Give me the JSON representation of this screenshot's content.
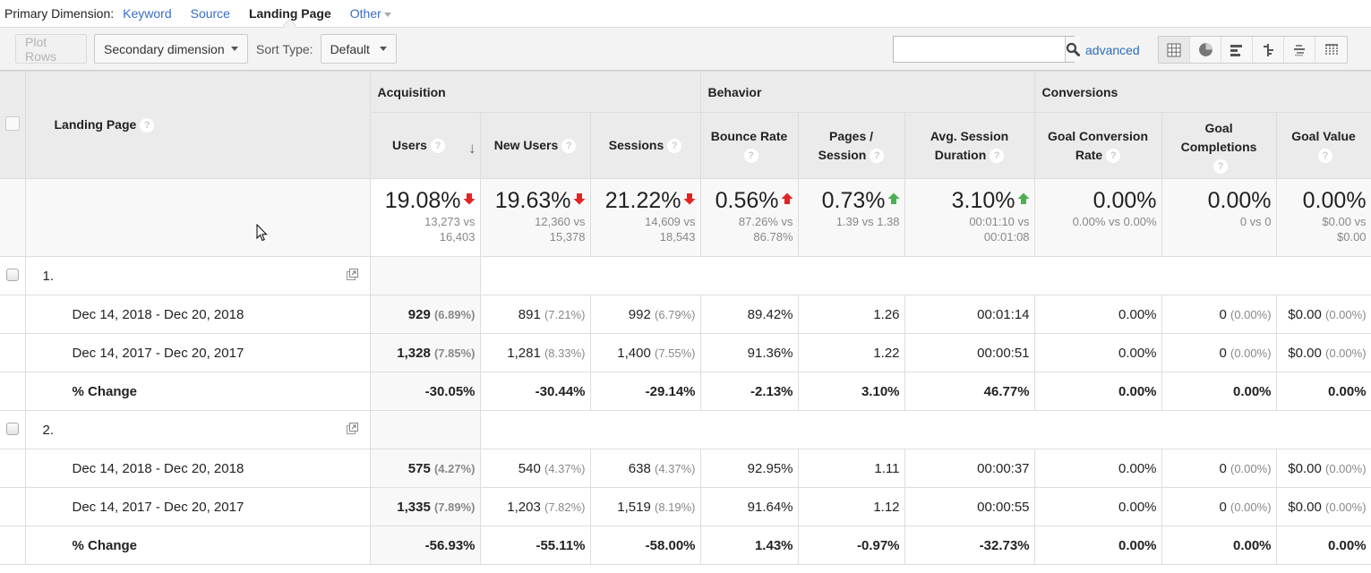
{
  "primary_dimension": {
    "label": "Primary Dimension:",
    "options": [
      "Keyword",
      "Source",
      "Landing Page",
      "Other"
    ],
    "active": "Landing Page"
  },
  "toolbar": {
    "plot_rows": "Plot Rows",
    "secondary_dimension": "Secondary dimension",
    "sort_type_label": "Sort Type:",
    "sort_type_value": "Default",
    "search_value": "",
    "search_placeholder": "",
    "advanced": "advanced",
    "view_icons": [
      "table-view-icon",
      "pie-view-icon",
      "performance-view-icon",
      "comparison-view-icon",
      "term-cloud-view-icon",
      "pivot-view-icon"
    ],
    "active_view": "table-view-icon"
  },
  "table": {
    "dimension_header": "Landing Page",
    "groups": [
      "Acquisition",
      "Behavior",
      "Conversions"
    ],
    "columns": [
      "Users",
      "New Users",
      "Sessions",
      "Bounce Rate",
      "Pages / Session",
      "Avg. Session Duration",
      "Goal Conversion Rate",
      "Goal Completions",
      "Goal Value"
    ],
    "column_lines": [
      [
        "Users"
      ],
      [
        "New Users"
      ],
      [
        "Sessions"
      ],
      [
        "Bounce Rate"
      ],
      [
        "Pages /",
        "Session"
      ],
      [
        "Avg. Session",
        "Duration"
      ],
      [
        "Goal Conversion",
        "Rate"
      ],
      [
        "Goal",
        "Completions"
      ],
      [
        "Goal Value"
      ]
    ],
    "sorted_column": "Users",
    "sort_direction": "descending",
    "summary": [
      {
        "change": "19.08%",
        "direction": "down",
        "color": "#e52222",
        "compare": [
          "13,273 vs",
          "16,403"
        ]
      },
      {
        "change": "19.63%",
        "direction": "down",
        "color": "#e52222",
        "compare": [
          "12,360 vs",
          "15,378"
        ]
      },
      {
        "change": "21.22%",
        "direction": "down",
        "color": "#e52222",
        "compare": [
          "14,609 vs",
          "18,543"
        ]
      },
      {
        "change": "0.56%",
        "direction": "up",
        "color": "#e52222",
        "compare": [
          "87.26% vs",
          "86.78%"
        ]
      },
      {
        "change": "0.73%",
        "direction": "up",
        "color": "#4caf50",
        "compare": [
          "1.39 vs 1.38"
        ]
      },
      {
        "change": "3.10%",
        "direction": "up",
        "color": "#4caf50",
        "compare": [
          "00:01:10 vs",
          "00:01:08"
        ]
      },
      {
        "change": "0.00%",
        "direction": "none",
        "color": "",
        "compare": [
          "0.00% vs 0.00%"
        ]
      },
      {
        "change": "0.00%",
        "direction": "none",
        "color": "",
        "compare": [
          "0 vs 0"
        ]
      },
      {
        "change": "0.00%",
        "direction": "none",
        "color": "",
        "compare": [
          "$0.00 vs",
          "$0.00"
        ]
      }
    ],
    "rows": [
      {
        "index": "1.",
        "periods": [
          {
            "label": "Dec 14, 2018 - Dec 20, 2018",
            "cells": [
              {
                "v": "929",
                "p": "(6.89%)"
              },
              {
                "v": "891",
                "p": "(7.21%)"
              },
              {
                "v": "992",
                "p": "(6.79%)"
              },
              {
                "v": "89.42%"
              },
              {
                "v": "1.26"
              },
              {
                "v": "00:01:14"
              },
              {
                "v": "0.00%"
              },
              {
                "v": "0",
                "p": "(0.00%)"
              },
              {
                "v": "$0.00",
                "p": "(0.00%)"
              }
            ]
          },
          {
            "label": "Dec 14, 2017 - Dec 20, 2017",
            "cells": [
              {
                "v": "1,328",
                "p": "(7.85%)"
              },
              {
                "v": "1,281",
                "p": "(8.33%)"
              },
              {
                "v": "1,400",
                "p": "(7.55%)"
              },
              {
                "v": "91.36%"
              },
              {
                "v": "1.22"
              },
              {
                "v": "00:00:51"
              },
              {
                "v": "0.00%"
              },
              {
                "v": "0",
                "p": "(0.00%)"
              },
              {
                "v": "$0.00",
                "p": "(0.00%)"
              }
            ]
          }
        ],
        "change_label": "% Change",
        "change": [
          "-30.05%",
          "-30.44%",
          "-29.14%",
          "-2.13%",
          "3.10%",
          "46.77%",
          "0.00%",
          "0.00%",
          "0.00%"
        ]
      },
      {
        "index": "2.",
        "periods": [
          {
            "label": "Dec 14, 2018 - Dec 20, 2018",
            "cells": [
              {
                "v": "575",
                "p": "(4.27%)"
              },
              {
                "v": "540",
                "p": "(4.37%)"
              },
              {
                "v": "638",
                "p": "(4.37%)"
              },
              {
                "v": "92.95%"
              },
              {
                "v": "1.11"
              },
              {
                "v": "00:00:37"
              },
              {
                "v": "0.00%"
              },
              {
                "v": "0",
                "p": "(0.00%)"
              },
              {
                "v": "$0.00",
                "p": "(0.00%)"
              }
            ]
          },
          {
            "label": "Dec 14, 2017 - Dec 20, 2017",
            "cells": [
              {
                "v": "1,335",
                "p": "(7.89%)"
              },
              {
                "v": "1,203",
                "p": "(7.82%)"
              },
              {
                "v": "1,519",
                "p": "(8.19%)"
              },
              {
                "v": "91.64%"
              },
              {
                "v": "1.12"
              },
              {
                "v": "00:00:55"
              },
              {
                "v": "0.00%"
              },
              {
                "v": "0",
                "p": "(0.00%)"
              },
              {
                "v": "$0.00",
                "p": "(0.00%)"
              }
            ]
          }
        ],
        "change_label": "% Change",
        "change": [
          "-56.93%",
          "-55.11%",
          "-58.00%",
          "1.43%",
          "-0.97%",
          "-32.73%",
          "0.00%",
          "0.00%",
          "0.00%"
        ]
      }
    ]
  }
}
